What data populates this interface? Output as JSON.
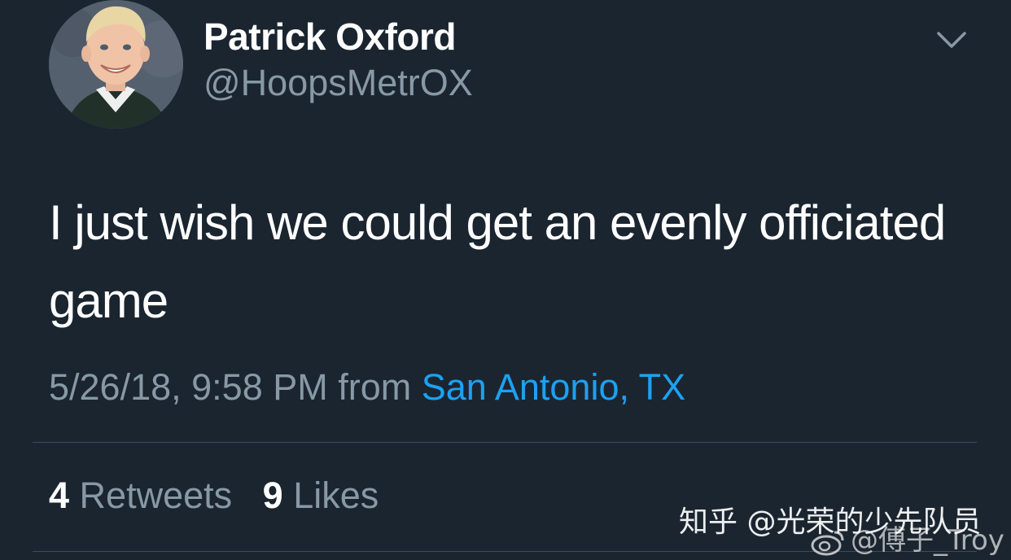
{
  "user": {
    "display_name": "Patrick Oxford",
    "handle": "@HoopsMetrOX"
  },
  "tweet": {
    "text": "I just wish we could get an evenly officiated game",
    "timestamp": "5/26/18, 9:58 PM",
    "from_label": "from",
    "location": "San Antonio, TX"
  },
  "stats": {
    "retweets_count": "4",
    "retweets_label": "Retweets",
    "likes_count": "9",
    "likes_label": "Likes"
  },
  "icons": {
    "menu": "chevron-down-icon",
    "avatar": "profile-photo"
  },
  "watermarks": {
    "zhihu": "知乎 @光荣的少先队员",
    "weibo": "@傅子_Troy"
  },
  "colors": {
    "background": "#1b2530",
    "text_primary": "#ffffff",
    "text_secondary": "#8899a6",
    "link": "#1da1f2",
    "divider": "#3d4a57"
  }
}
